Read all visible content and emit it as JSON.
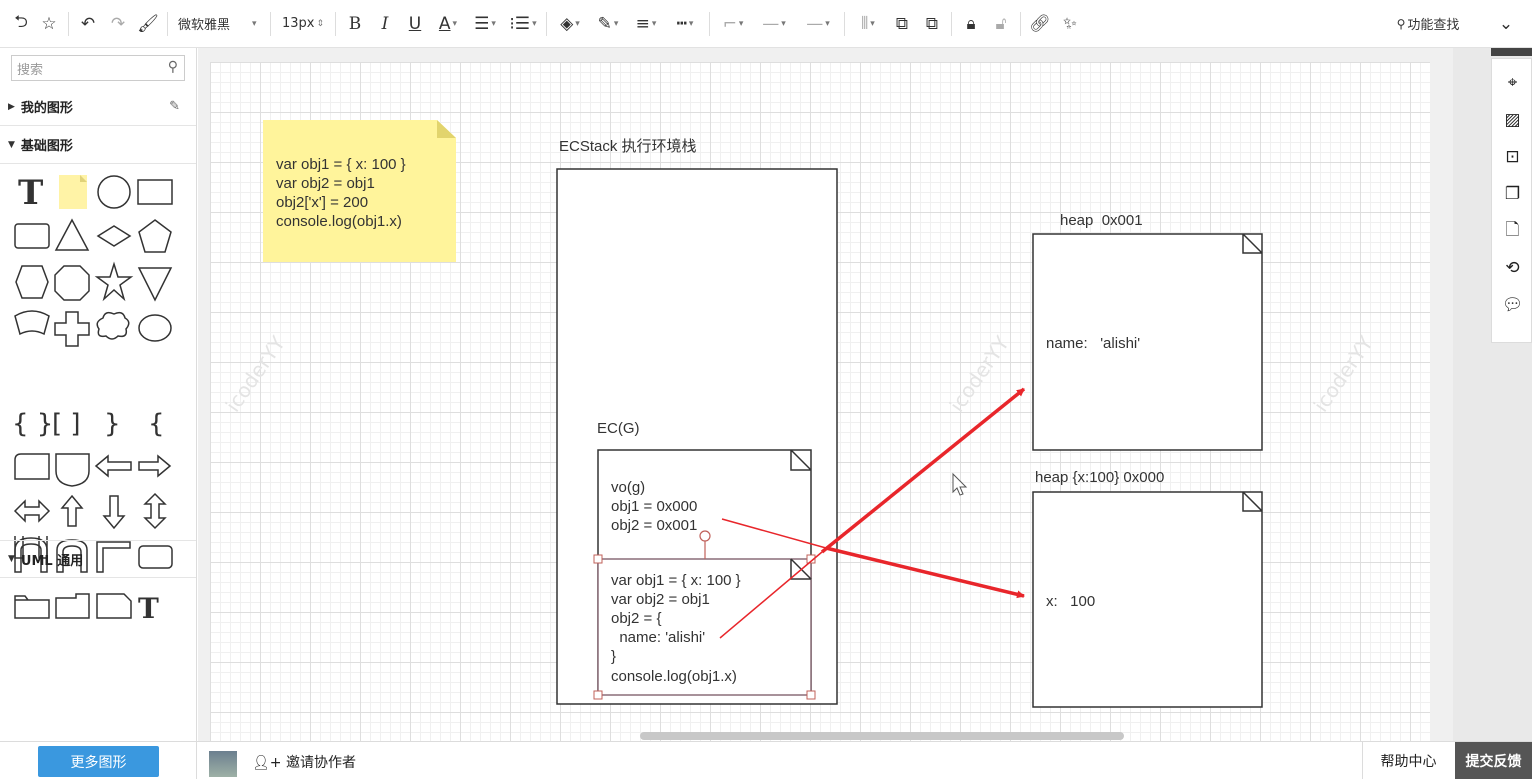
{
  "toolbar": {
    "font_name": "微软雅黑",
    "font_size": "13px",
    "function_search": "功能查找"
  },
  "left_panel": {
    "search_placeholder": "搜索",
    "sections": {
      "my_shapes": "我的图形",
      "basic_shapes": "基础图形",
      "uml": "UML 通用"
    },
    "more_shapes_button": "更多图形"
  },
  "canvas": {
    "sticky_note_lines": [
      "var obj1 = { x: 100 }",
      "var obj2 = obj1",
      "obj2['x'] = 200",
      "console.log(obj1.x)"
    ],
    "ecstack_label": "ECStack 执行环境栈",
    "ecg_label": "EC(G)",
    "vo_lines": [
      "vo(g)",
      "obj1 = 0x000",
      "obj2 = 0x001"
    ],
    "code_lines": [
      "var obj1 = { x: 100 }",
      "var obj2 = obj1",
      "obj2 = {",
      "  name: 'alishi'",
      "}",
      "console.log(obj1.x)"
    ],
    "heap1_label": "heap  0x001",
    "heap1_content": "name:   'alishi'",
    "heap2_label": "heap {x:100} 0x000",
    "heap2_content": "x:   100",
    "watermark": "icoderYY",
    "arrow_color": "#e8262b"
  },
  "bottom_bar": {
    "invite": "邀请协作者",
    "help": "帮助中心",
    "feedback": "提交反馈"
  }
}
